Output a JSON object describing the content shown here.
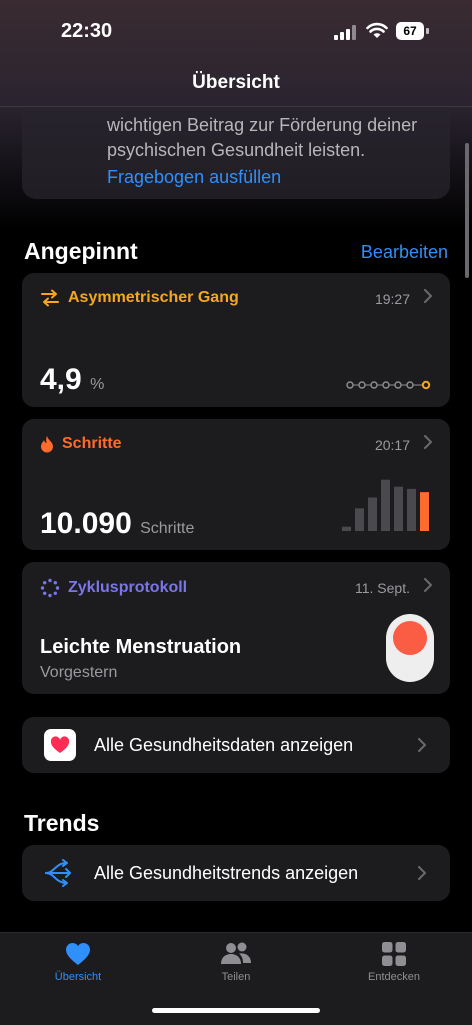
{
  "status": {
    "time": "22:30",
    "battery": "67"
  },
  "nav": {
    "title": "Übersicht"
  },
  "survey": {
    "text": "wichtigen Beitrag zur Förderung deiner psychischen Gesundheit leisten.",
    "link": "Fragebogen ausfüllen"
  },
  "pinned": {
    "title": "Angepinnt",
    "edit": "Bearbeiten",
    "cards": [
      {
        "title": "Asymmetrischer Gang",
        "time": "19:27",
        "value": "4,9",
        "unit": "%",
        "color": "#f5a623"
      },
      {
        "title": "Schritte",
        "time": "20:17",
        "value": "10.090",
        "unit": "Schritte",
        "color": "#ff6b2c",
        "bars": [
          0.08,
          0.42,
          0.62,
          0.95,
          0.82,
          0.78,
          0.72
        ]
      },
      {
        "title": "Zyklusprotokoll",
        "time": "11. Sept.",
        "value": "Leichte Menstruation",
        "sub": "Vorgestern",
        "color": "#7a76e8"
      }
    ],
    "all_data": "Alle Gesundheitsdaten anzeigen"
  },
  "trends": {
    "title": "Trends",
    "all_trends": "Alle Gesundheitstrends anzeigen"
  },
  "tabbar": {
    "overview": "Übersicht",
    "share": "Teilen",
    "discover": "Entdecken"
  },
  "colors": {
    "accent": "#2f8ffb",
    "card": "#1c1c1e",
    "gait": "#f5a623",
    "steps": "#ff6b2c",
    "cycle": "#7a76e8"
  }
}
